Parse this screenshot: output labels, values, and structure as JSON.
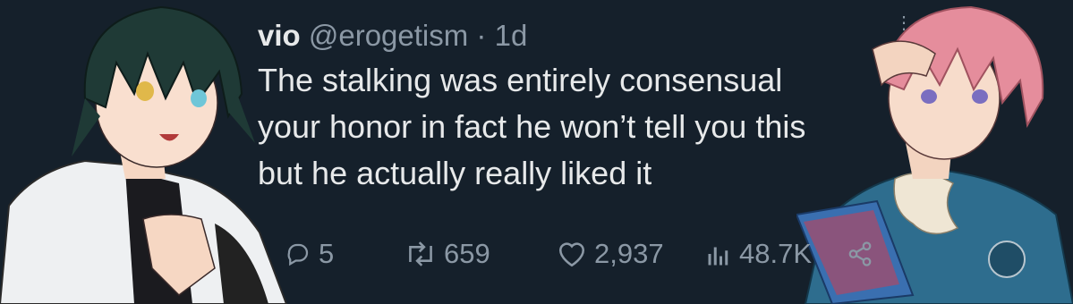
{
  "tweet": {
    "display_name": "vio",
    "handle": "@erogetism",
    "separator": "·",
    "time": "1d",
    "lines": [
      "The stalking was entirely consensual",
      "your honor in fact he won’t tell you this",
      "but he actually really liked it"
    ]
  },
  "actions": {
    "replies": "5",
    "retweets": "659",
    "likes": "2,937",
    "views": "48.7K"
  },
  "icons": {
    "reply": "reply-icon",
    "retweet": "retweet-icon",
    "like": "heart-icon",
    "views": "views-icon",
    "share": "share-icon",
    "more": "more-icon"
  },
  "colors": {
    "background": "#15202b",
    "text": "#e7e9ea",
    "muted": "#8b98a5"
  }
}
